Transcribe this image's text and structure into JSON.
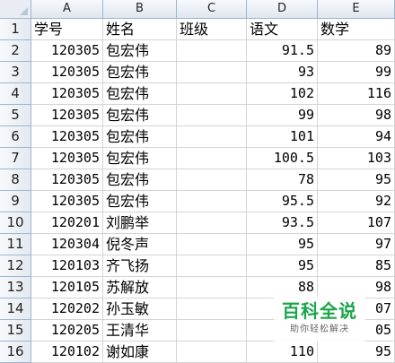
{
  "columns": [
    "A",
    "B",
    "C",
    "D",
    "E"
  ],
  "rows": [
    {
      "num": "1",
      "A": "学号",
      "B": "姓名",
      "C": "班级",
      "D": "语文",
      "E": "数学"
    },
    {
      "num": "2",
      "A": "120305",
      "B": "包宏伟",
      "C": "",
      "D": "91.5",
      "E": "89"
    },
    {
      "num": "3",
      "A": "120305",
      "B": "包宏伟",
      "C": "",
      "D": "93",
      "E": "99"
    },
    {
      "num": "4",
      "A": "120305",
      "B": "包宏伟",
      "C": "",
      "D": "102",
      "E": "116"
    },
    {
      "num": "5",
      "A": "120305",
      "B": "包宏伟",
      "C": "",
      "D": "99",
      "E": "98"
    },
    {
      "num": "6",
      "A": "120305",
      "B": "包宏伟",
      "C": "",
      "D": "101",
      "E": "94"
    },
    {
      "num": "7",
      "A": "120305",
      "B": "包宏伟",
      "C": "",
      "D": "100.5",
      "E": "103"
    },
    {
      "num": "8",
      "A": "120305",
      "B": "包宏伟",
      "C": "",
      "D": "78",
      "E": "95"
    },
    {
      "num": "9",
      "A": "120305",
      "B": "包宏伟",
      "C": "",
      "D": "95.5",
      "E": "92"
    },
    {
      "num": "10",
      "A": "120201",
      "B": "刘鹏举",
      "C": "",
      "D": "93.5",
      "E": "107"
    },
    {
      "num": "11",
      "A": "120304",
      "B": "倪冬声",
      "C": "",
      "D": "95",
      "E": "97"
    },
    {
      "num": "12",
      "A": "120103",
      "B": "齐飞扬",
      "C": "",
      "D": "95",
      "E": "85"
    },
    {
      "num": "13",
      "A": "120105",
      "B": "苏解放",
      "C": "",
      "D": "88",
      "E": "98"
    },
    {
      "num": "14",
      "A": "120202",
      "B": "孙玉敏",
      "C": "",
      "D": "",
      "E": "07"
    },
    {
      "num": "15",
      "A": "120205",
      "B": "王清华",
      "C": "",
      "D": "",
      "E": "05"
    },
    {
      "num": "16",
      "A": "120102",
      "B": "谢如康",
      "C": "",
      "D": "110",
      "E": "95"
    }
  ],
  "watermark": {
    "title": "百科全说",
    "subtitle": "助你轻松解决"
  }
}
